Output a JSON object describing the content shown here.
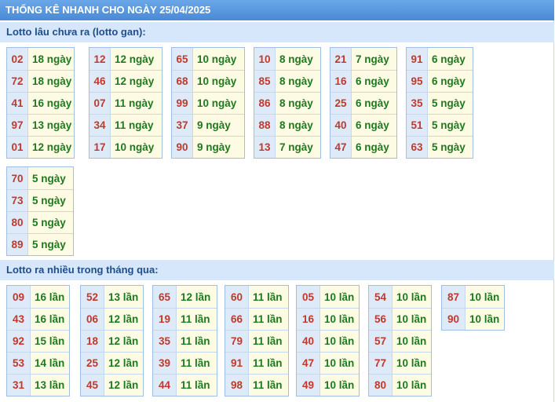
{
  "title": "THỐNG KÊ NHANH CHO NGÀY 25/04/2025",
  "gan": {
    "heading": "Lotto lâu chưa ra (lotto gan):",
    "blocks": [
      [
        {
          "n": "02",
          "v": "18 ngày"
        },
        {
          "n": "72",
          "v": "18 ngày"
        },
        {
          "n": "41",
          "v": "16 ngày"
        },
        {
          "n": "97",
          "v": "13 ngày"
        },
        {
          "n": "01",
          "v": "12 ngày"
        }
      ],
      [
        {
          "n": "12",
          "v": "12 ngày"
        },
        {
          "n": "46",
          "v": "12 ngày"
        },
        {
          "n": "07",
          "v": "11 ngày"
        },
        {
          "n": "34",
          "v": "11 ngày"
        },
        {
          "n": "17",
          "v": "10 ngày"
        }
      ],
      [
        {
          "n": "65",
          "v": "10 ngày"
        },
        {
          "n": "68",
          "v": "10 ngày"
        },
        {
          "n": "99",
          "v": "10 ngày"
        },
        {
          "n": "37",
          "v": "9 ngày"
        },
        {
          "n": "90",
          "v": "9 ngày"
        }
      ],
      [
        {
          "n": "10",
          "v": "8 ngày"
        },
        {
          "n": "85",
          "v": "8 ngày"
        },
        {
          "n": "86",
          "v": "8 ngày"
        },
        {
          "n": "88",
          "v": "8 ngày"
        },
        {
          "n": "13",
          "v": "7 ngày"
        }
      ],
      [
        {
          "n": "21",
          "v": "7 ngày"
        },
        {
          "n": "16",
          "v": "6 ngày"
        },
        {
          "n": "25",
          "v": "6 ngày"
        },
        {
          "n": "40",
          "v": "6 ngày"
        },
        {
          "n": "47",
          "v": "6 ngày"
        }
      ],
      [
        {
          "n": "91",
          "v": "6 ngày"
        },
        {
          "n": "95",
          "v": "6 ngày"
        },
        {
          "n": "35",
          "v": "5 ngày"
        },
        {
          "n": "51",
          "v": "5 ngày"
        },
        {
          "n": "63",
          "v": "5 ngày"
        }
      ],
      [
        {
          "n": "70",
          "v": "5 ngày"
        },
        {
          "n": "73",
          "v": "5 ngày"
        },
        {
          "n": "80",
          "v": "5 ngày"
        },
        {
          "n": "89",
          "v": "5 ngày"
        }
      ]
    ]
  },
  "frequent": {
    "heading": "Lotto ra nhiều trong tháng qua:",
    "blocks": [
      [
        {
          "n": "09",
          "v": "16 lần"
        },
        {
          "n": "43",
          "v": "16 lần"
        },
        {
          "n": "92",
          "v": "15 lần"
        },
        {
          "n": "53",
          "v": "14 lần"
        },
        {
          "n": "31",
          "v": "13 lần"
        }
      ],
      [
        {
          "n": "52",
          "v": "13 lần"
        },
        {
          "n": "06",
          "v": "12 lần"
        },
        {
          "n": "18",
          "v": "12 lần"
        },
        {
          "n": "25",
          "v": "12 lần"
        },
        {
          "n": "45",
          "v": "12 lần"
        }
      ],
      [
        {
          "n": "65",
          "v": "12 lần"
        },
        {
          "n": "19",
          "v": "11 lần"
        },
        {
          "n": "35",
          "v": "11 lần"
        },
        {
          "n": "39",
          "v": "11 lần"
        },
        {
          "n": "44",
          "v": "11 lần"
        }
      ],
      [
        {
          "n": "60",
          "v": "11 lần"
        },
        {
          "n": "66",
          "v": "11 lần"
        },
        {
          "n": "79",
          "v": "11 lần"
        },
        {
          "n": "91",
          "v": "11 lần"
        },
        {
          "n": "98",
          "v": "11 lần"
        }
      ],
      [
        {
          "n": "05",
          "v": "10 lần"
        },
        {
          "n": "16",
          "v": "10 lần"
        },
        {
          "n": "40",
          "v": "10 lần"
        },
        {
          "n": "47",
          "v": "10 lần"
        },
        {
          "n": "49",
          "v": "10 lần"
        }
      ],
      [
        {
          "n": "54",
          "v": "10 lần"
        },
        {
          "n": "56",
          "v": "10 lần"
        },
        {
          "n": "57",
          "v": "10 lần"
        },
        {
          "n": "77",
          "v": "10 lần"
        },
        {
          "n": "80",
          "v": "10 lần"
        }
      ],
      [
        {
          "n": "87",
          "v": "10 lần"
        },
        {
          "n": "90",
          "v": "10 lần"
        }
      ]
    ]
  }
}
